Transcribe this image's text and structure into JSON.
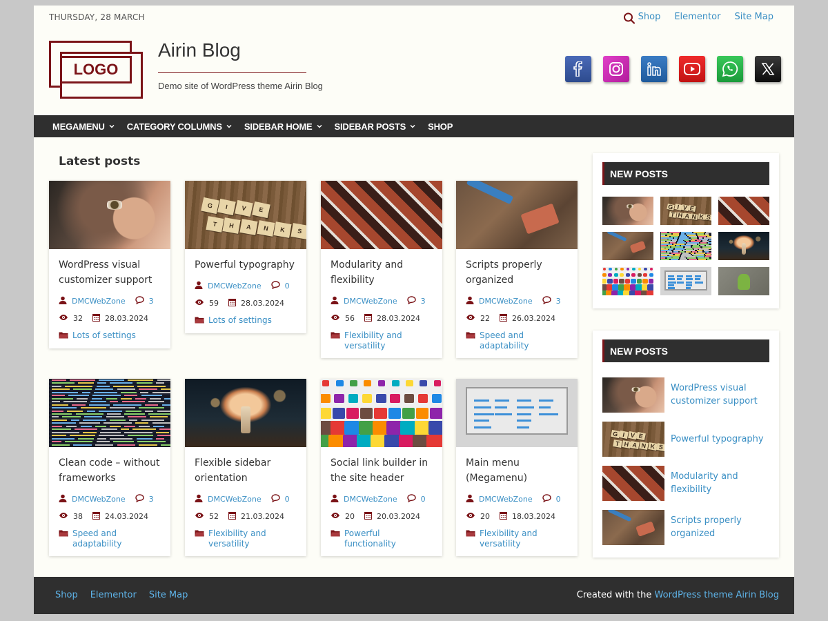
{
  "top_bar": {
    "date": "THURSDAY, 28 MARCH",
    "links": [
      "Shop",
      "Elementor",
      "Site Map"
    ]
  },
  "header": {
    "logo_text": "LOGO",
    "site_title": "Airin Blog",
    "tagline": "Demo site of WordPress theme Airin Blog"
  },
  "socials": [
    {
      "icon": "facebook-icon",
      "color": "#3b5998"
    },
    {
      "icon": "instagram-icon",
      "color": "#c13584"
    },
    {
      "icon": "linkedin-icon",
      "color": "#0e76a8"
    },
    {
      "icon": "youtube-icon",
      "color": "#e52d27"
    },
    {
      "icon": "whatsapp-icon",
      "color": "#25d366"
    },
    {
      "icon": "x-icon",
      "color": "#111111"
    }
  ],
  "nav": {
    "items": [
      "MEGAMENU",
      "CATEGORY COLUMNS",
      "SIDEBAR HOME",
      "SIDEBAR POSTS",
      "SHOP"
    ]
  },
  "main": {
    "heading": "Latest posts",
    "posts": [
      {
        "title": "WordPress visual customizer support",
        "author": "DMCWebZone",
        "comments": "3",
        "views": "32",
        "date": "28.03.2024",
        "category": "Lots of settings",
        "image": "face"
      },
      {
        "title": "Powerful typography",
        "author": "DMCWebZone",
        "comments": "0",
        "views": "59",
        "date": "28.03.2024",
        "category": "Lots of settings",
        "image": "wood"
      },
      {
        "title": "Modularity and flexibility",
        "author": "DMCWebZone",
        "comments": "3",
        "views": "56",
        "date": "28.03.2024",
        "category": "Flexibility and versatility",
        "image": "brick"
      },
      {
        "title": "Scripts properly organized",
        "author": "DMCWebZone",
        "comments": "3",
        "views": "22",
        "date": "26.03.2024",
        "category": "Speed and adaptability",
        "image": "tools"
      },
      {
        "title": "Clean code – without frameworks",
        "author": "DMCWebZone",
        "comments": "3",
        "views": "38",
        "date": "24.03.2024",
        "category": "Speed and adaptability",
        "image": "code"
      },
      {
        "title": "Flexible sidebar orientation",
        "author": "DMCWebZone",
        "comments": "0",
        "views": "52",
        "date": "21.03.2024",
        "category": "Flexibility and versatility",
        "image": "mushroom"
      },
      {
        "title": "Social link builder in the site header",
        "author": "DMCWebZone",
        "comments": "0",
        "views": "20",
        "date": "20.03.2024",
        "category": "Powerful functionality",
        "image": "apps"
      },
      {
        "title": "Main menu (Megamenu)",
        "author": "DMCWebZone",
        "comments": "0",
        "views": "20",
        "date": "18.03.2024",
        "category": "Flexibility and versatility",
        "image": "menu"
      }
    ]
  },
  "sidebar": {
    "grid_widget": {
      "title": "NEW POSTS",
      "images": [
        "face",
        "wood",
        "brick",
        "tools",
        "code",
        "mushroom",
        "apps",
        "menu",
        "android"
      ]
    },
    "list_widget": {
      "title": "NEW POSTS",
      "items": [
        {
          "title": "WordPress visual customizer support",
          "image": "face"
        },
        {
          "title": "Powerful typography",
          "image": "wood"
        },
        {
          "title": "Modularity and flexibility",
          "image": "brick"
        },
        {
          "title": "Scripts properly organized",
          "image": "tools"
        }
      ]
    }
  },
  "footer": {
    "links": [
      "Shop",
      "Elementor",
      "Site Map"
    ],
    "credit_prefix": "Created with the",
    "credit_link": "WordPress theme Airin Blog"
  },
  "colors": {
    "accent": "#7b1418",
    "link": "#3a8fc4",
    "dark_bar": "#2f2f2f",
    "page_bg": "#fdfdf7"
  }
}
